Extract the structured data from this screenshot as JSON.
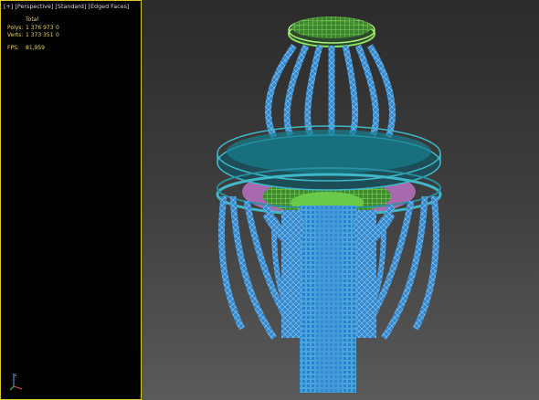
{
  "viewport": {
    "label": "[+] [Perspective] [Standard] [Edged Faces]",
    "stats": {
      "header": "Total",
      "polys_label": "Polys:",
      "polys_total": "1 376 973",
      "polys_selected": "0",
      "verts_label": "Verts:",
      "verts_total": "1 373 351",
      "verts_selected": "0",
      "fps_label": "FPS:",
      "fps_value": "81,959"
    }
  },
  "colors": {
    "viewport_border": "#e3c12a",
    "stats_text": "#e6d35a",
    "wire_blue": "#4aa8e6",
    "wire_cyan": "#39d4e8",
    "wire_green": "#7cd85a",
    "wire_pink": "#e08ae6",
    "ring_teal": "#167f8e"
  },
  "model": {
    "icon": "chandelier-wireframe-icon"
  }
}
